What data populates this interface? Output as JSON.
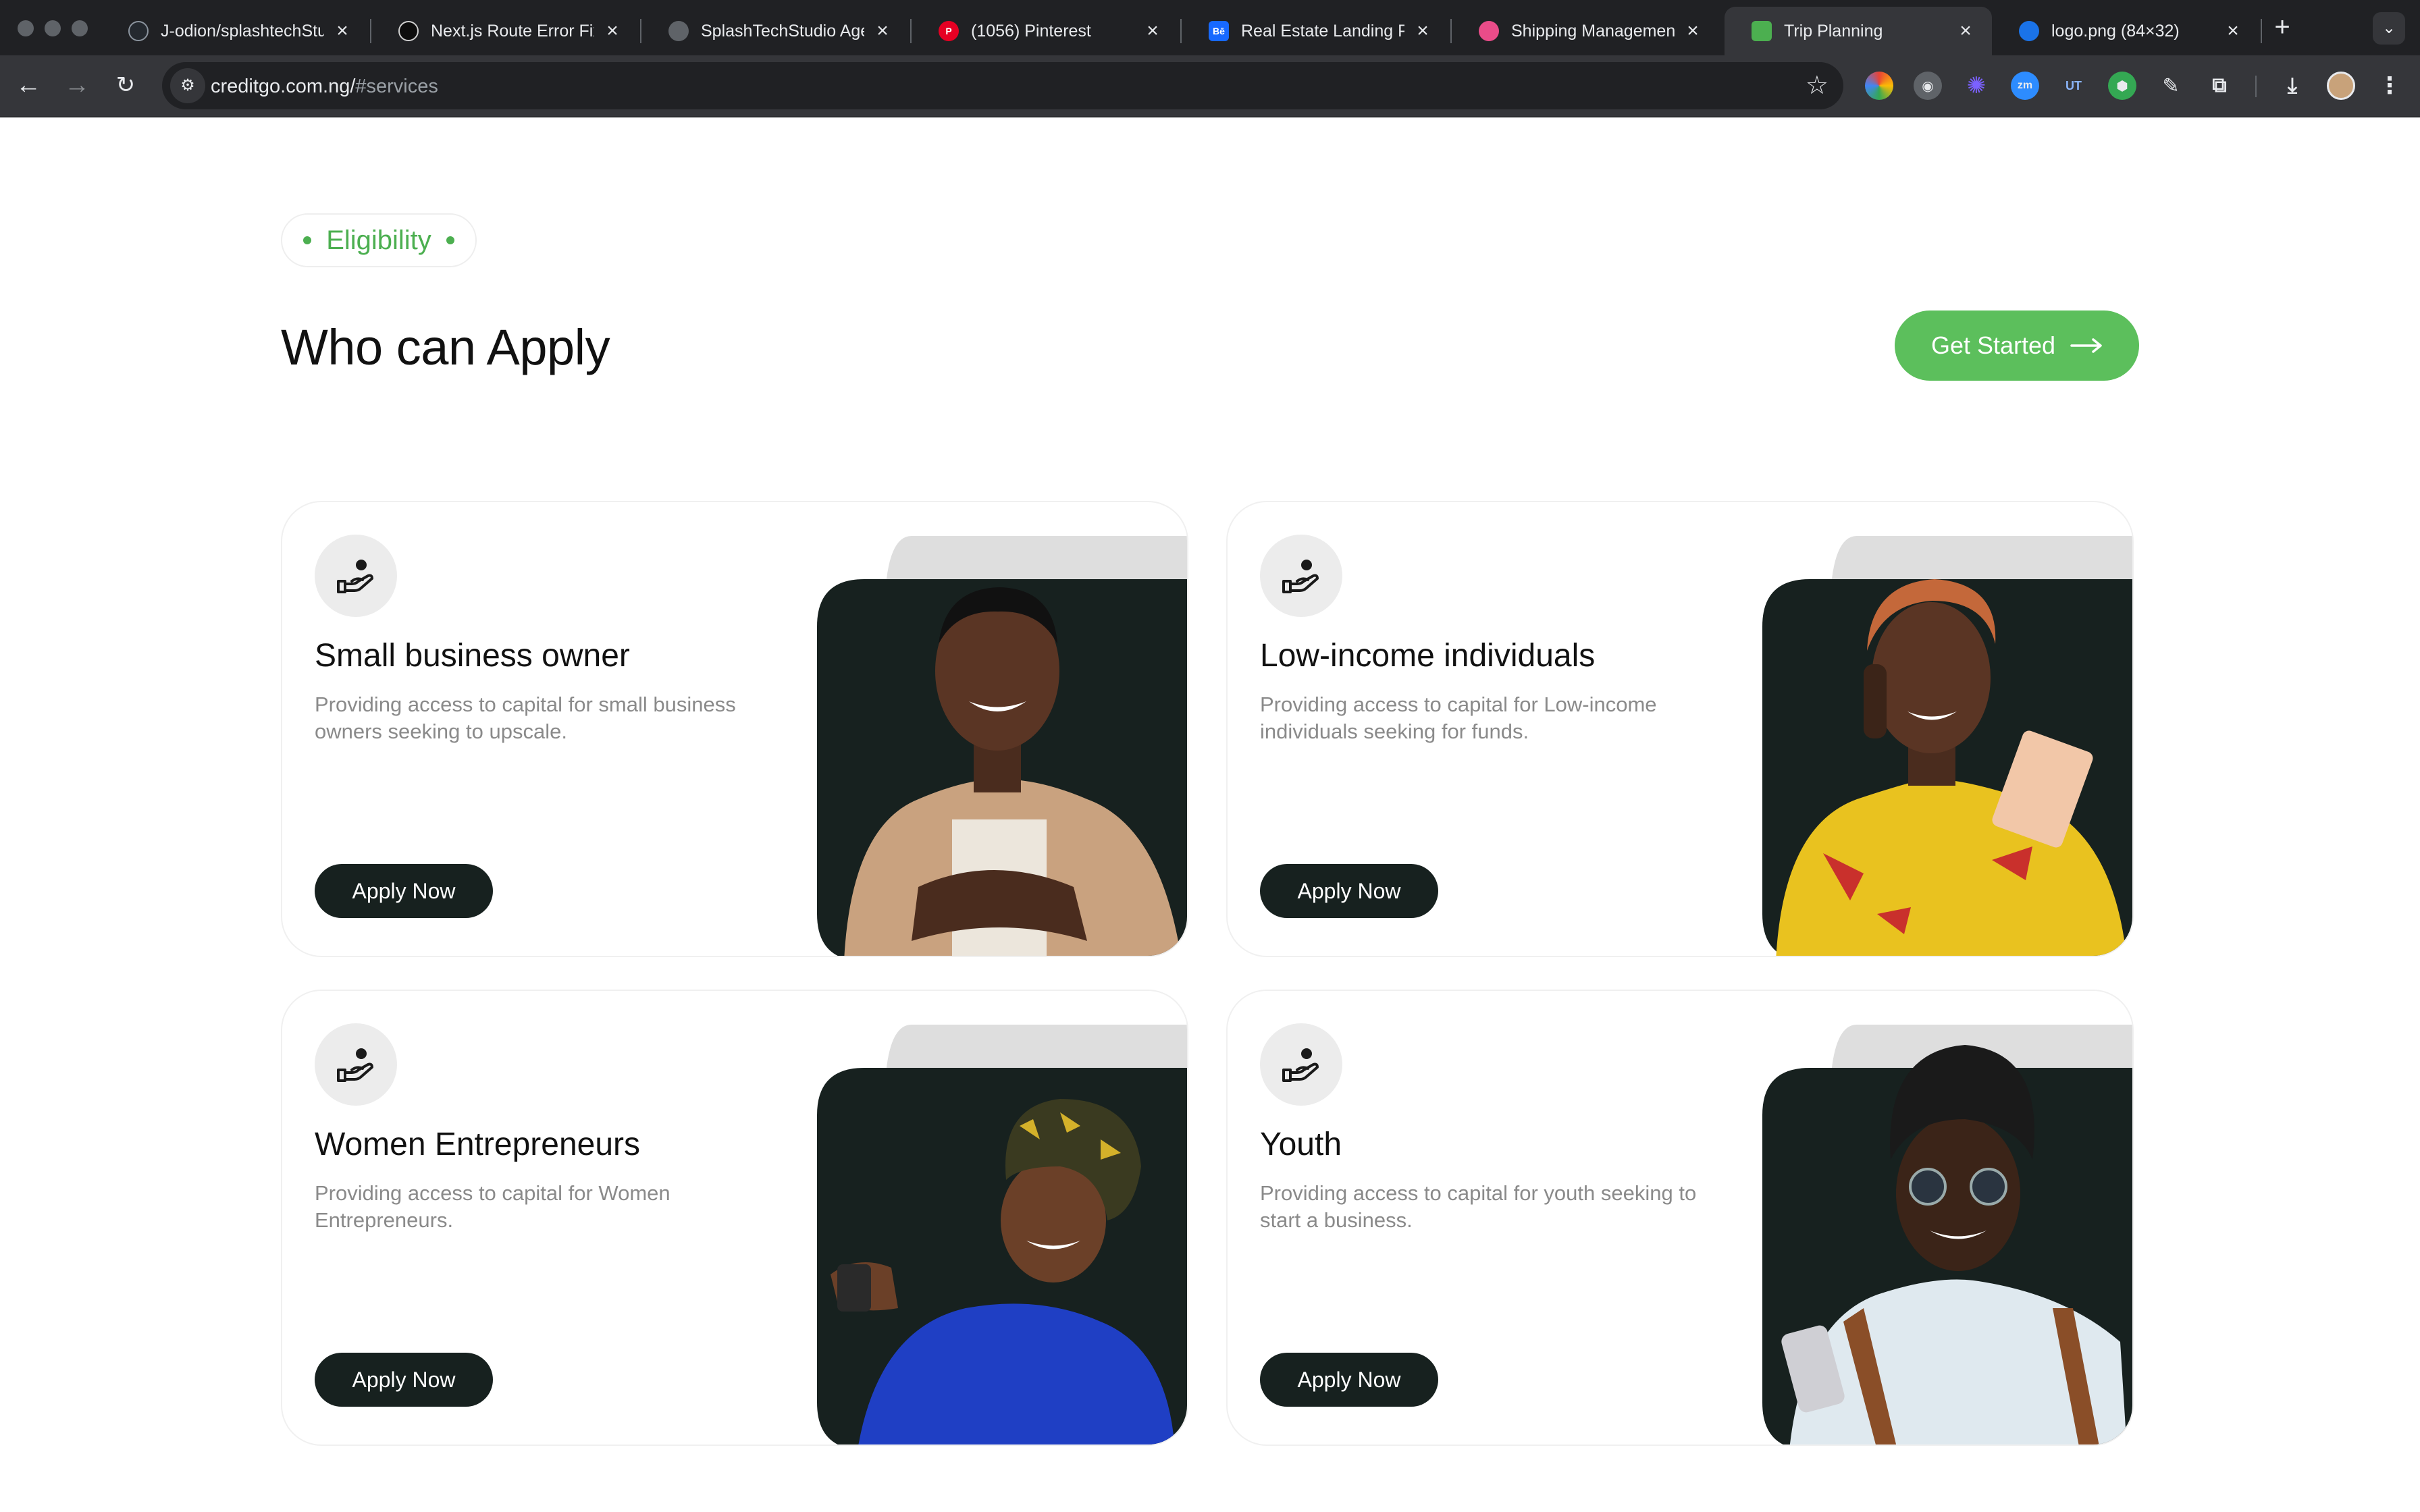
{
  "browser": {
    "tabs": [
      {
        "title": "J-odion/splashtechStu",
        "favicon_color": "#24292f",
        "favicon_glyph": "github-icon"
      },
      {
        "title": "Next.js Route Error Fix",
        "favicon_color": "#10a37f",
        "favicon_glyph": "chatgpt-icon"
      },
      {
        "title": "SplashTechStudio Agen",
        "favicon_color": "#5f6368",
        "favicon_glyph": "globe-icon"
      },
      {
        "title": "(1056) Pinterest",
        "favicon_color": "#e60023",
        "favicon_glyph": "pinterest-icon"
      },
      {
        "title": "Real Estate Landing Pa",
        "favicon_color": "#1769ff",
        "favicon_glyph": "behance-icon"
      },
      {
        "title": "Shipping Management",
        "favicon_color": "#c13584",
        "favicon_glyph": "dribbble-icon"
      },
      {
        "title": "Trip Planning",
        "favicon_color": "#4caf50",
        "favicon_glyph": "figma-icon"
      },
      {
        "title": "logo.png (84×32)",
        "favicon_color": "#1a73e8",
        "favicon_glyph": "image-icon"
      }
    ],
    "active_tab_index": 6,
    "url_host": "creditgo.com.ng/",
    "url_path": "#services"
  },
  "section": {
    "eyebrow": "Eligibility",
    "title": "Who can Apply",
    "cta_label": "Get Started"
  },
  "cards": [
    {
      "title": "Small business owner",
      "description": "Providing access to capital for small business owners seeking to upscale.",
      "button_label": "Apply Now",
      "photo": "man-in-apron-photo"
    },
    {
      "title": "Low-income individuals",
      "description": "Providing access to capital for Low-income individuals seeking for funds.",
      "button_label": "Apply Now",
      "photo": "woman-with-phone-and-cash-photo"
    },
    {
      "title": "Women Entrepreneurs",
      "description": "Providing access to capital for Women Entrepreneurs.",
      "button_label": "Apply Now",
      "photo": "woman-in-headwrap-with-phone-photo"
    },
    {
      "title": "Youth",
      "description": "Providing access to capital for youth seeking to start a business.",
      "button_label": "Apply Now",
      "photo": "young-man-with-phone-photo"
    }
  ],
  "colors": {
    "accent_green": "#5cbf5c",
    "eyebrow_green": "#4caf50",
    "dark_button": "#17211f",
    "photo_panel": "#17211f",
    "photo_back_panel": "#dedede",
    "browser_dark": "#202124",
    "browser_toolbar": "#35363a"
  }
}
